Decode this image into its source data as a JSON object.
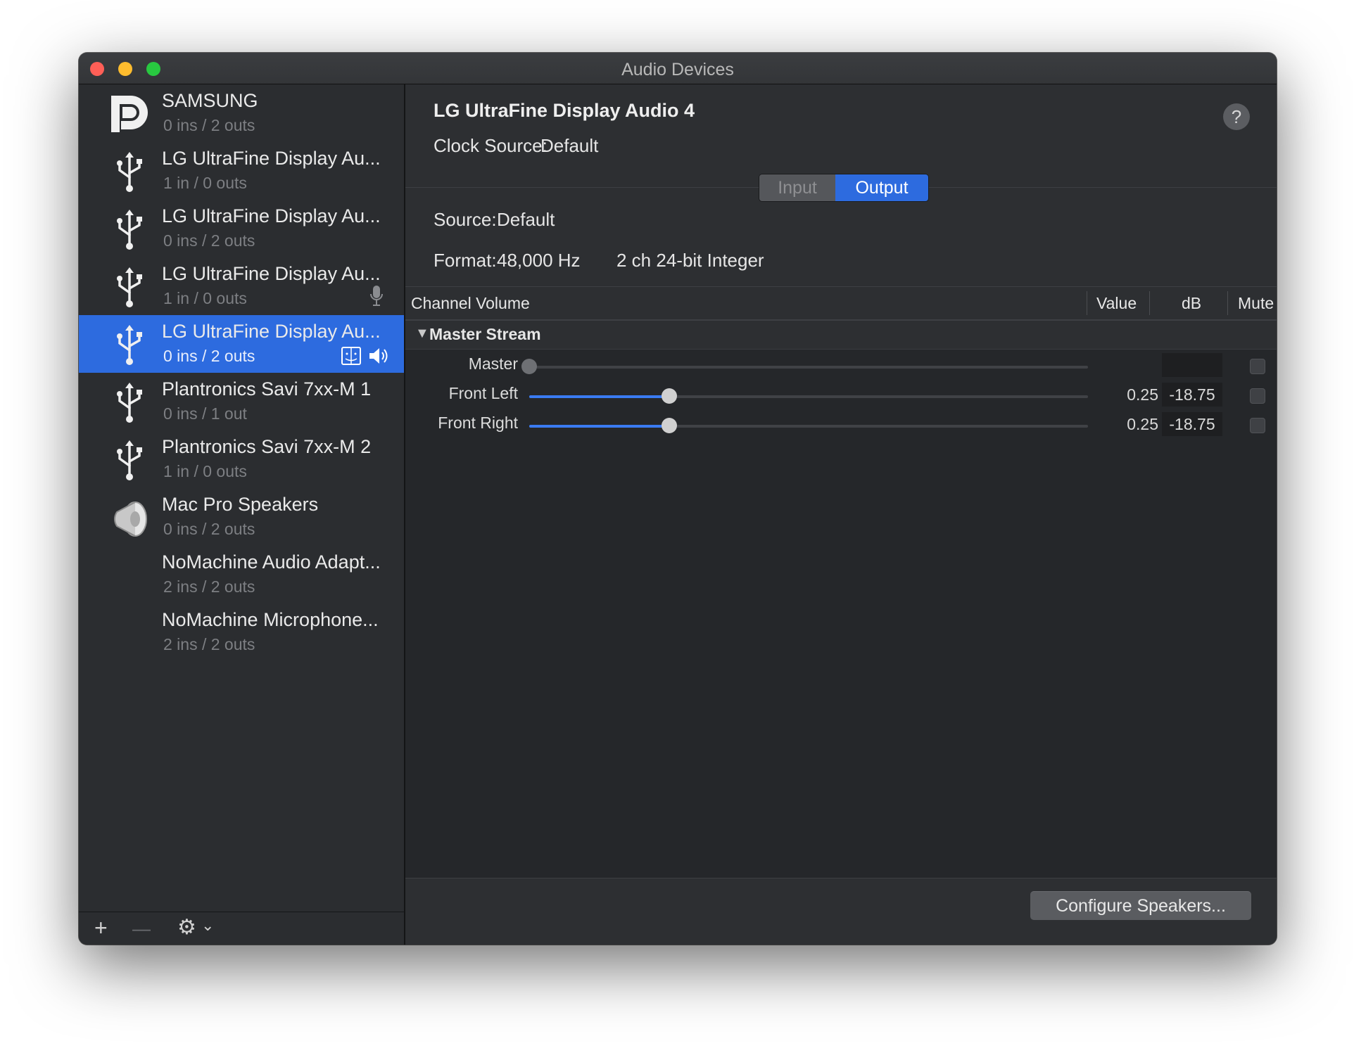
{
  "window": {
    "title": "Audio Devices"
  },
  "devices": [
    {
      "name": "SAMSUNG",
      "io": "0 ins / 2 outs",
      "icon": "displayport-icon"
    },
    {
      "name": "LG UltraFine Display Au...",
      "io": "1 in / 0 outs",
      "icon": "usb-icon"
    },
    {
      "name": "LG UltraFine Display Au...",
      "io": "0 ins / 2 outs",
      "icon": "usb-icon"
    },
    {
      "name": "LG UltraFine Display Au...",
      "io": "1 in / 0 outs",
      "icon": "usb-icon",
      "badge": "microphone-icon"
    },
    {
      "name": "LG UltraFine Display Au...",
      "io": "0 ins / 2 outs",
      "icon": "usb-icon",
      "selected": true,
      "badges": [
        "finder-icon",
        "speaker-icon"
      ]
    },
    {
      "name": "Plantronics Savi 7xx-M 1",
      "io": "0 ins / 1 out",
      "icon": "usb-icon"
    },
    {
      "name": "Plantronics Savi 7xx-M 2",
      "io": "1 in / 0 outs",
      "icon": "usb-icon"
    },
    {
      "name": "Mac Pro Speakers",
      "io": "0 ins / 2 outs",
      "icon": "speaker-cone-icon"
    },
    {
      "name": "NoMachine Audio Adapt...",
      "io": "2 ins / 2 outs"
    },
    {
      "name": "NoMachine Microphone...",
      "io": "2 ins / 2 outs"
    }
  ],
  "sidebar_footer": {
    "add": "+",
    "remove": "—",
    "gear": "⚙",
    "chevron": "⌄"
  },
  "detail": {
    "title": "LG UltraFine Display Audio 4",
    "clock_label": "Clock Source:",
    "clock_value": "Default",
    "help": "?",
    "tabs": {
      "input": "Input",
      "output": "Output",
      "selected": "Output"
    },
    "source_label": "Source:",
    "source_value": "Default",
    "format_label": "Format:",
    "format_rate": "48,000 Hz",
    "format_type": "2 ch 24-bit Integer"
  },
  "table": {
    "headers": {
      "channel": "Channel Volume",
      "value": "Value",
      "db": "dB",
      "mute": "Mute"
    },
    "group": "Master Stream",
    "rows": [
      {
        "label": "Master",
        "value": "",
        "db": "",
        "level": 0
      },
      {
        "label": "Front Left",
        "value": "0.25",
        "db": "-18.75",
        "level": 0.25
      },
      {
        "label": "Front Right",
        "value": "0.25",
        "db": "-18.75",
        "level": 0.25
      }
    ]
  },
  "footer": {
    "configure": "Configure Speakers..."
  },
  "colors": {
    "accent": "#2d6bdf",
    "slider": "#3a7bf2"
  }
}
